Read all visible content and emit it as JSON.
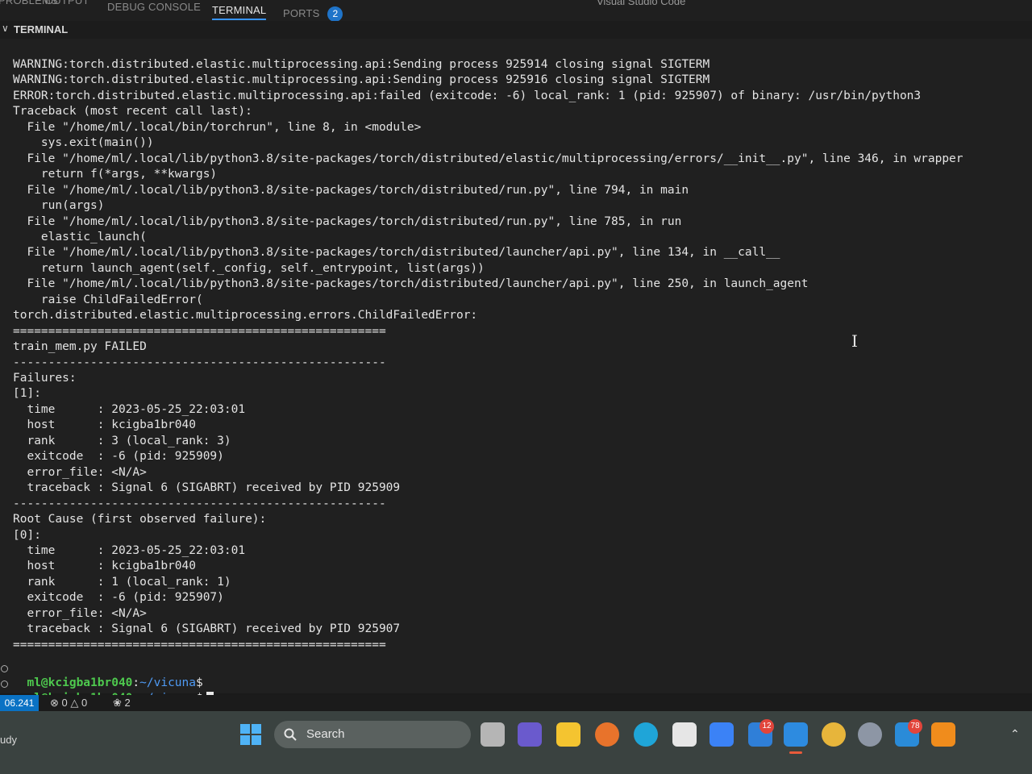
{
  "window_title": "Visual Studio Code",
  "panel_tabs": [
    "PROBLEMS",
    "OUTPUT",
    "DEBUG CONSOLE",
    "TERMINAL",
    "PORTS"
  ],
  "ports_count": "2",
  "terminal_header": "TERMINAL",
  "terminal_lines": [
    "WARNING:torch.distributed.elastic.multiprocessing.api:Sending process 925914 closing signal SIGTERM",
    "WARNING:torch.distributed.elastic.multiprocessing.api:Sending process 925916 closing signal SIGTERM",
    "ERROR:torch.distributed.elastic.multiprocessing.api:failed (exitcode: -6) local_rank: 1 (pid: 925907) of binary: /usr/bin/python3",
    "Traceback (most recent call last):",
    "  File \"/home/ml/.local/bin/torchrun\", line 8, in <module>",
    "    sys.exit(main())",
    "  File \"/home/ml/.local/lib/python3.8/site-packages/torch/distributed/elastic/multiprocessing/errors/__init__.py\", line 346, in wrapper",
    "    return f(*args, **kwargs)",
    "  File \"/home/ml/.local/lib/python3.8/site-packages/torch/distributed/run.py\", line 794, in main",
    "    run(args)",
    "  File \"/home/ml/.local/lib/python3.8/site-packages/torch/distributed/run.py\", line 785, in run",
    "    elastic_launch(",
    "  File \"/home/ml/.local/lib/python3.8/site-packages/torch/distributed/launcher/api.py\", line 134, in __call__",
    "    return launch_agent(self._config, self._entrypoint, list(args))",
    "  File \"/home/ml/.local/lib/python3.8/site-packages/torch/distributed/launcher/api.py\", line 250, in launch_agent",
    "    raise ChildFailedError(",
    "torch.distributed.elastic.multiprocessing.errors.ChildFailedError:",
    "=====================================================",
    "train_mem.py FAILED",
    "-----------------------------------------------------",
    "Failures:",
    "[1]:",
    "  time      : 2023-05-25_22:03:01",
    "  host      : kcigba1br040",
    "  rank      : 3 (local_rank: 3)",
    "  exitcode  : -6 (pid: 925909)",
    "  error_file: <N/A>",
    "  traceback : Signal 6 (SIGABRT) received by PID 925909",
    "-----------------------------------------------------",
    "Root Cause (first observed failure):",
    "[0]:",
    "  time      : 2023-05-25_22:03:01",
    "  host      : kcigba1br040",
    "  rank      : 1 (local_rank: 1)",
    "  exitcode  : -6 (pid: 925907)",
    "  error_file: <N/A>",
    "  traceback : Signal 6 (SIGABRT) received by PID 925907",
    "====================================================="
  ],
  "prompt": {
    "user": "ml@kcigba1br040",
    "sep": ":",
    "path": "~/vicuna",
    "sign": "$"
  },
  "statusbar": {
    "remote": "06.241",
    "errors": "0",
    "warnings": "0",
    "ports": "2"
  },
  "taskbar": {
    "weather": "udy",
    "search_label": "Search",
    "badge_teams": "12",
    "badge_mail": "78"
  },
  "colors": {
    "accent": "#3794ff",
    "prompt_user": "#4ec94e",
    "prompt_path": "#4f9bf5",
    "status_remote": "#0a72c4"
  }
}
